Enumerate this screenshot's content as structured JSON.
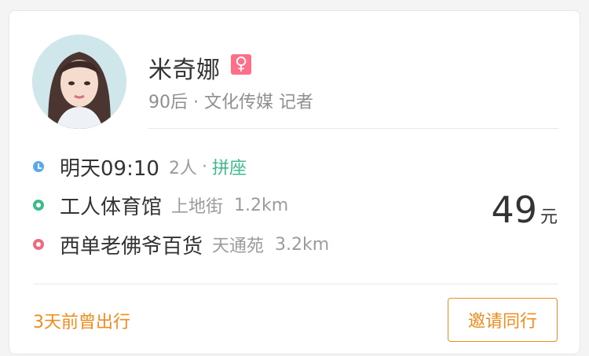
{
  "profile": {
    "name": "米奇娜",
    "gender_symbol": "♀",
    "subtitle": "90后 · 文化传媒 记者"
  },
  "trip": {
    "time": "明天09:10",
    "people": "2人",
    "separator": "·",
    "mode": "拼座",
    "start": {
      "name": "工人体育馆",
      "area": "上地街",
      "distance": "1.2km"
    },
    "end": {
      "name": "西单老佛爷百货",
      "area": "天通苑",
      "distance": "3.2km"
    }
  },
  "price": {
    "amount": "49",
    "unit": "元"
  },
  "footer": {
    "history": "3天前曾出行",
    "invite_label": "邀请同行"
  },
  "colors": {
    "accent": "#f08c1e",
    "green": "#3dbb8a",
    "female": "#ff6f8a",
    "time_dot": "#5aa9e8",
    "end_dot": "#ef6a7c"
  },
  "icons": {
    "gender": "female-icon",
    "time": "clock-icon",
    "start": "start-dot-icon",
    "end": "end-dot-icon"
  }
}
